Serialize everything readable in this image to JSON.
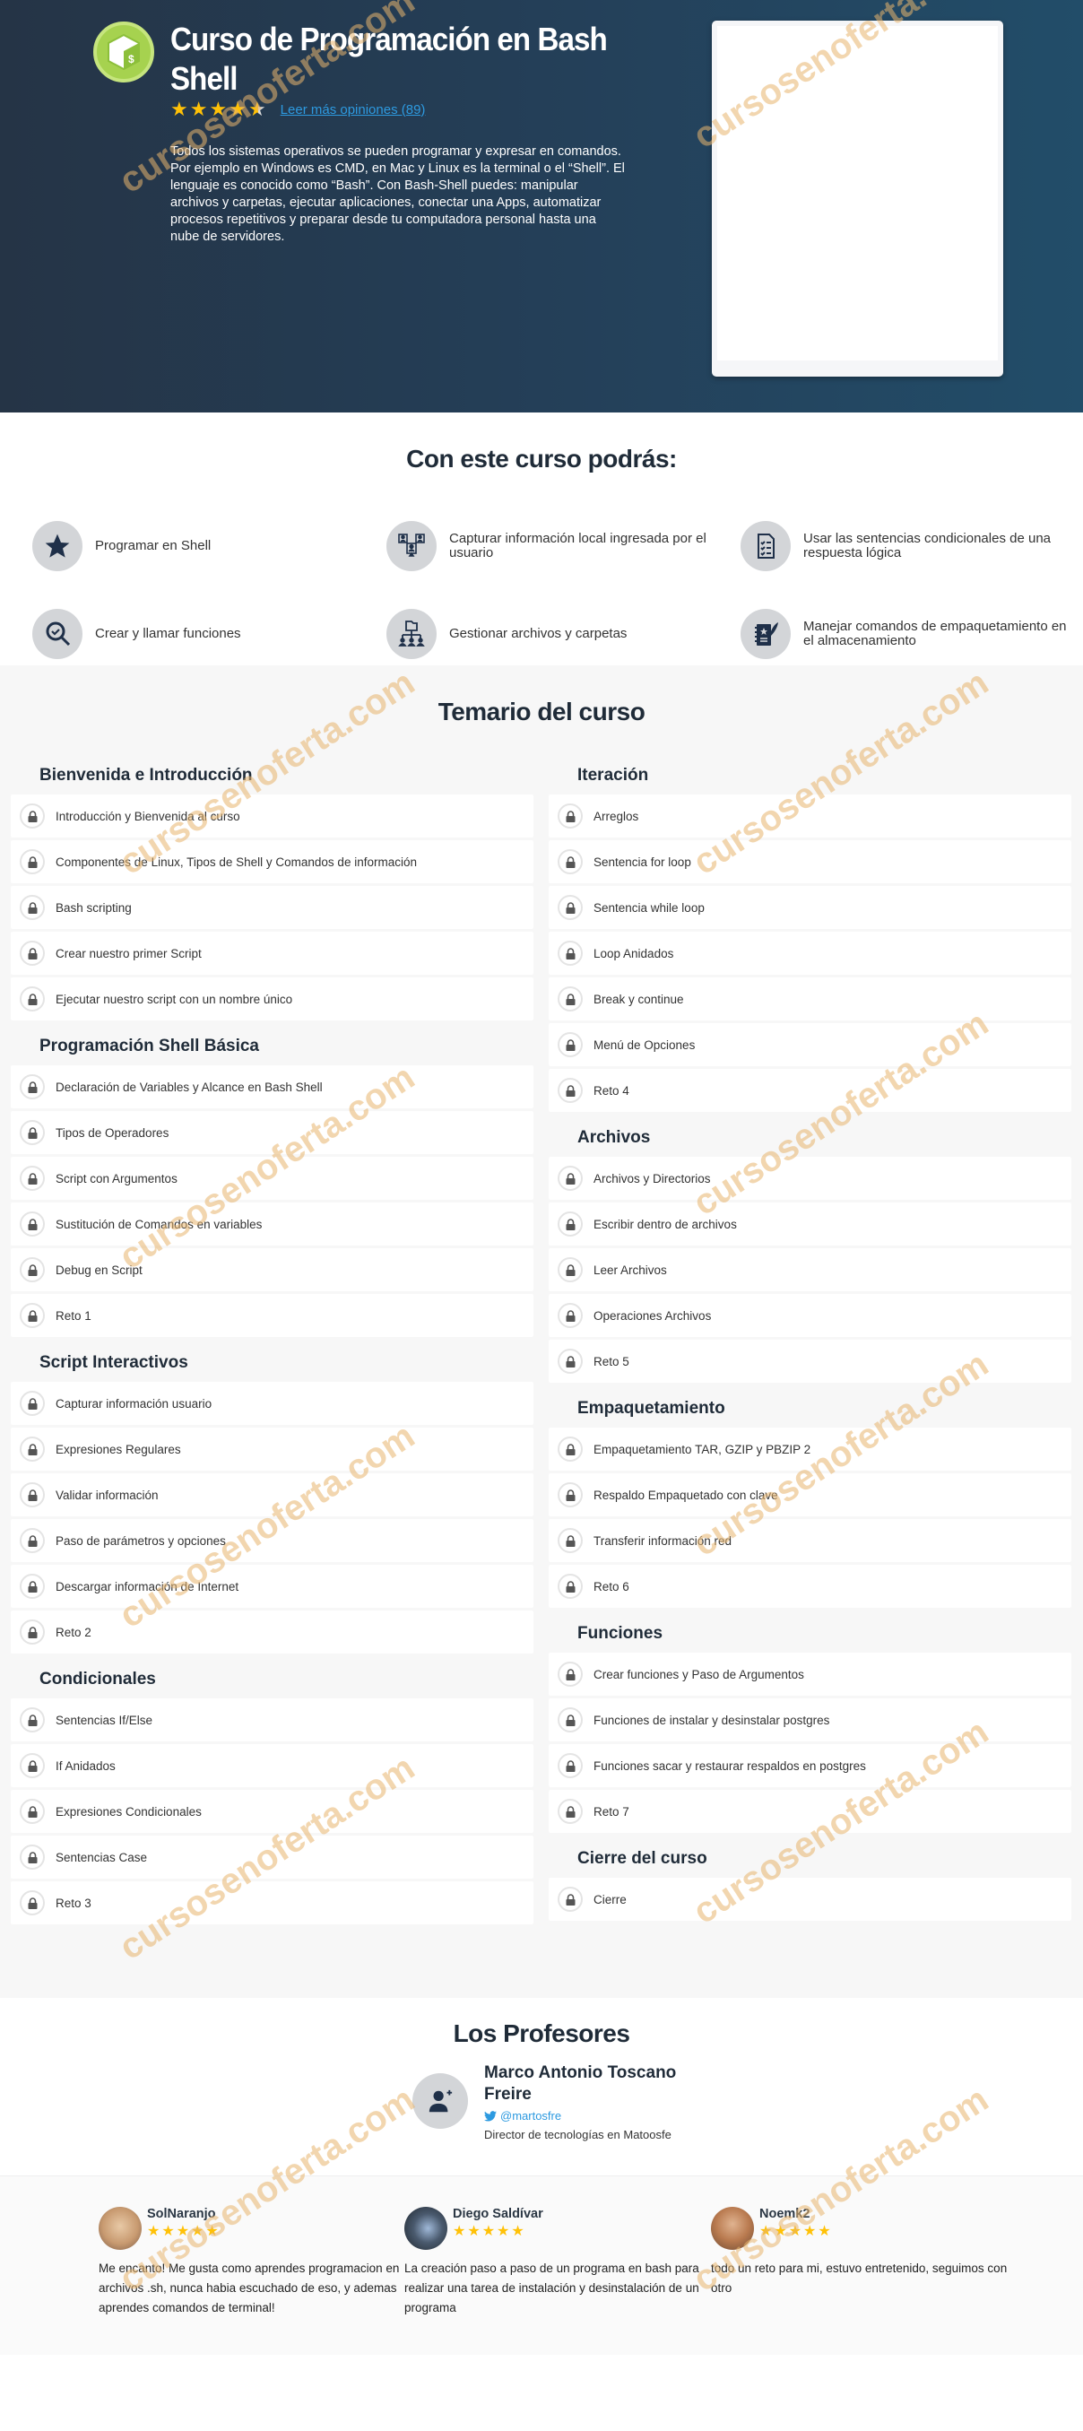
{
  "hero": {
    "title": "Curso de Programación en Bash Shell",
    "rating": 4.5,
    "reviews_link": "Leer más opiniones (89)",
    "description": "Todos los sistemas operativos se pueden programar y expresar en comandos. Por ejemplo en Windows es CMD, en Mac y Linux es la terminal o el “Shell”. El lenguaje es conocido como “Bash”. Con Bash-Shell puedes: manipular archivos y carpetas, ejecutar aplicaciones, conectar una Apps, automatizar procesos repetitivos y preparar desde tu computadora personal hasta una nube de servidores.",
    "logo_icon": "bash-shell-logo-icon",
    "brand_color": "#a6d24f"
  },
  "benefits": {
    "title": "Con este curso podrás:",
    "items": [
      {
        "icon": "star-icon",
        "label": "Programar en Shell"
      },
      {
        "icon": "users-network-icon",
        "label": "Capturar información local ingresada por el usuario"
      },
      {
        "icon": "checklist-document-icon",
        "label": "Usar las sentencias condicionales de una respuesta lógica"
      },
      {
        "icon": "search-check-icon",
        "label": "Crear y llamar funciones"
      },
      {
        "icon": "folder-hierarchy-icon",
        "label": "Gestionar archivos y carpetas"
      },
      {
        "icon": "notebook-quill-icon",
        "label": "Manejar comandos de empaquetamiento en el almacenamiento"
      }
    ]
  },
  "syllabus": {
    "title": "Temario del curso",
    "left_modules": [
      {
        "title": "Bienvenida e Introducción",
        "lessons": [
          "Introducción y Bienvenida al curso",
          "Componentes de Linux, Tipos de Shell y Comandos de información",
          "Bash scripting",
          "Crear nuestro primer Script",
          "Ejecutar nuestro script con un nombre único"
        ]
      },
      {
        "title": "Programación Shell Básica",
        "lessons": [
          "Declaración de Variables y Alcance en Bash Shell",
          "Tipos de Operadores",
          "Script con Argumentos",
          "Sustitución de Comandos en variables",
          "Debug en Script",
          "Reto 1"
        ]
      },
      {
        "title": "Script Interactivos",
        "lessons": [
          "Capturar información usuario",
          "Expresiones Regulares",
          "Validar información",
          "Paso de parámetros y opciones",
          "Descargar información de Internet",
          "Reto 2"
        ]
      },
      {
        "title": "Condicionales",
        "lessons": [
          "Sentencias If/Else",
          "If Anidados",
          "Expresiones Condicionales",
          "Sentencias Case",
          "Reto 3"
        ]
      }
    ],
    "right_modules": [
      {
        "title": "Iteración",
        "lessons": [
          "Arreglos",
          "Sentencia for loop",
          "Sentencia while loop",
          "Loop Anidados",
          "Break y continue",
          "Menú de Opciones",
          "Reto 4"
        ]
      },
      {
        "title": "Archivos",
        "lessons": [
          "Archivos y Directorios",
          "Escribir dentro de archivos",
          "Leer Archivos",
          "Operaciones Archivos",
          "Reto 5"
        ]
      },
      {
        "title": "Empaquetamiento",
        "lessons": [
          "Empaquetamiento TAR, GZIP y PBZIP 2",
          "Respaldo Empaquetado con clave",
          "Transferir información red",
          "Reto 6"
        ]
      },
      {
        "title": "Funciones",
        "lessons": [
          "Crear funciones y Paso de Argumentos",
          "Funciones de instalar y desinstalar postgres",
          "Funciones sacar y restaurar respaldos en postgres",
          "Reto 7"
        ]
      },
      {
        "title": "Cierre del curso",
        "lessons": [
          "Cierre"
        ]
      }
    ]
  },
  "professors": {
    "title": "Los Profesores",
    "items": [
      {
        "name": "Marco Antonio Toscano Freire",
        "twitter": "@martosfre",
        "role": "Director de tecnologías en Matoosfe"
      }
    ]
  },
  "testimonials": [
    {
      "name": "SolNaranjo",
      "stars": 5,
      "text": "Me encanto! Me gusta como aprendes programacion en archivos .sh, nunca habia escuchado de eso, y ademas aprendes comandos de terminal!"
    },
    {
      "name": "Diego Saldívar",
      "stars": 5,
      "text": "La creación paso a paso de un programa en bash para realizar una tarea de instalación y desinstalación de un programa"
    },
    {
      "name": "Noemk2",
      "stars": 5,
      "text": "todo un reto para mi, estuvo entretenido, seguimos con otro"
    }
  ],
  "watermark": "cursosenoferta.com"
}
